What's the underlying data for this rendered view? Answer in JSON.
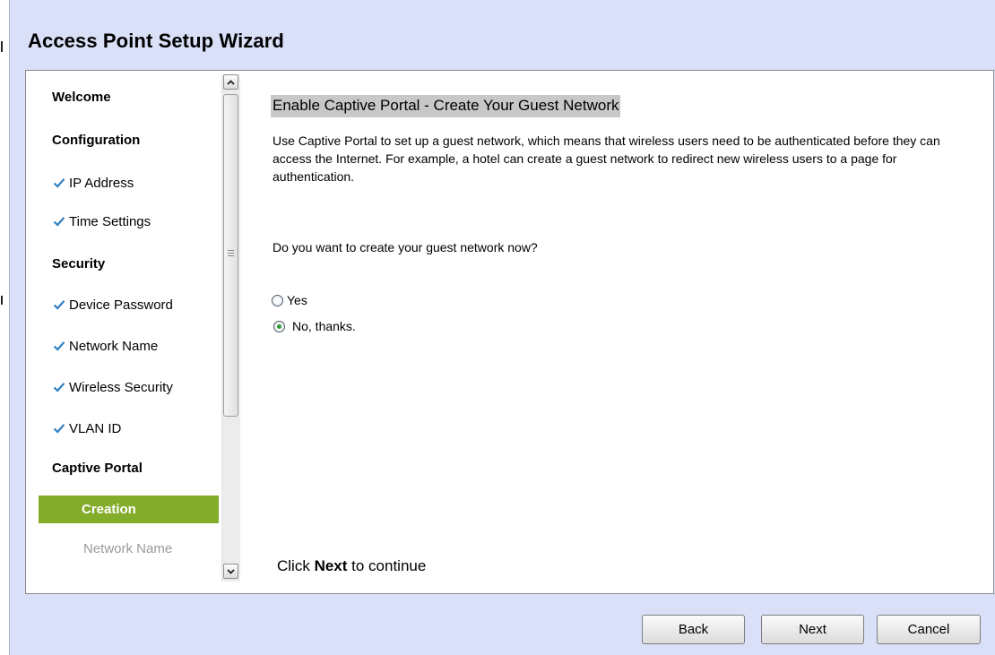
{
  "window": {
    "title": "Access Point Setup Wizard"
  },
  "sidebar": {
    "items": [
      {
        "label": "Welcome",
        "kind": "section"
      },
      {
        "label": "Configuration",
        "kind": "section"
      },
      {
        "label": "IP Address",
        "kind": "step",
        "completed": true
      },
      {
        "label": "Time Settings",
        "kind": "step",
        "completed": true
      },
      {
        "label": "Security",
        "kind": "section"
      },
      {
        "label": "Device Password",
        "kind": "step",
        "completed": true
      },
      {
        "label": "Network Name",
        "kind": "step",
        "completed": true
      },
      {
        "label": "Wireless Security",
        "kind": "step",
        "completed": true
      },
      {
        "label": "VLAN ID",
        "kind": "step",
        "completed": true
      },
      {
        "label": "Captive Portal",
        "kind": "section"
      },
      {
        "label": "Creation",
        "kind": "active"
      },
      {
        "label": "Network Name",
        "kind": "disabled"
      }
    ]
  },
  "content": {
    "heading": "Enable Captive Portal - Create Your Guest Network",
    "description": "Use Captive Portal to set up a guest network, which means that wireless users need to be authenticated before they can access the Internet. For example, a hotel can create a guest network to redirect new wireless users to a page for authentication.",
    "question": "Do you want to create your guest network now?",
    "options": [
      {
        "label": "Yes",
        "selected": false
      },
      {
        "label": "No, thanks.",
        "selected": true
      }
    ],
    "hint_prefix": "Click ",
    "hint_bold": "Next",
    "hint_suffix": " to continue"
  },
  "buttons": {
    "back": "Back",
    "next": "Next",
    "cancel": "Cancel"
  },
  "colors": {
    "window_bg": "#d9e0f7",
    "active_step": "#83ac2b",
    "check": "#2f7fc1",
    "heading_highlight": "#c8c8c8"
  }
}
